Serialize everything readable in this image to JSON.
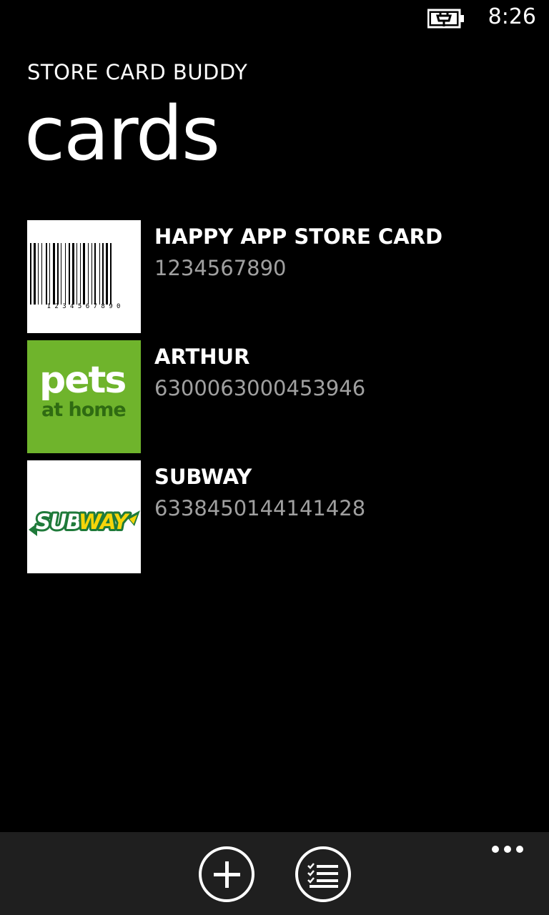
{
  "status_bar": {
    "battery_icon": "battery-charging-icon",
    "time": "8:26"
  },
  "header": {
    "app_title": "STORE CARD BUDDY",
    "page_title": "cards"
  },
  "cards": [
    {
      "name": "HAPPY APP STORE CARD",
      "number": "1234567890",
      "thumbnail": "barcode",
      "barcode_text": "1 2 3 4 5 6 7 8 9 0"
    },
    {
      "name": "ARTHUR",
      "number": "6300063000453946",
      "thumbnail": "pets-at-home-logo",
      "logo_text_main": "pets",
      "logo_text_sub": "at home"
    },
    {
      "name": "SUBWAY",
      "number": "6338450144141428",
      "thumbnail": "subway-logo",
      "logo_text_1": "SUB",
      "logo_text_2": "WAY"
    }
  ],
  "app_bar": {
    "buttons": [
      {
        "icon": "add-icon"
      },
      {
        "icon": "list-check-icon"
      }
    ],
    "more_icon": "ellipsis-icon"
  },
  "colors": {
    "background": "#000000",
    "app_bar": "#1f1f1f",
    "secondary_text": "#a0a0a0",
    "pets_green": "#6fb42c",
    "pets_dark_green": "#2f6b12",
    "subway_green": "#1f7a3a",
    "subway_yellow": "#f5d50a"
  }
}
